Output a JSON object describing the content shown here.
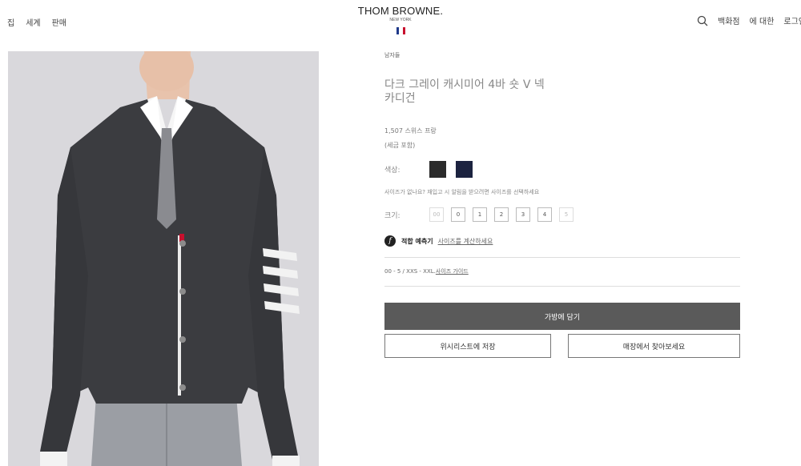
{
  "nav": {
    "left_items": [
      "집",
      "세계",
      "판매"
    ],
    "right_items": [
      "백화점",
      "에 대한",
      "로그인"
    ]
  },
  "brand": {
    "name": "THOM BROWNE.",
    "city": "NEW YORK",
    "flag_colors": [
      "#1f3a8a",
      "#ffffff",
      "#c8102e"
    ]
  },
  "product": {
    "gender": "남자들",
    "title": "다크 그레이 캐시미어 4바 숏 V 넥 카디건",
    "price": "1,507 스위스 프랑",
    "tax_note": "(세금 포함)",
    "color_label": "색상:",
    "colors": [
      {
        "name": "dark-grey",
        "hex": "#2b2b2b"
      },
      {
        "name": "navy",
        "hex": "#1c2340"
      }
    ],
    "size_prompt": "사이즈가 없나요? 재입고 시 알림을 받으려면 사이즈를 선택하세요",
    "size_label": "크기:",
    "sizes": [
      {
        "label": "00",
        "available": false
      },
      {
        "label": "0",
        "available": true
      },
      {
        "label": "1",
        "available": true
      },
      {
        "label": "2",
        "available": true
      },
      {
        "label": "3",
        "available": true
      },
      {
        "label": "4",
        "available": true
      },
      {
        "label": "5",
        "available": false
      }
    ],
    "fit_label": "적합 예측기",
    "fit_link": "사이즈를 계산하세요",
    "size_range": "00 - 5 / XXS - XXL.",
    "size_guide_link": "사이즈 가이드"
  },
  "actions": {
    "add_to_bag": "가방에 담기",
    "wishlist": "위시리스트에 저장",
    "find_in_store": "매장에서 찾아보세요"
  }
}
